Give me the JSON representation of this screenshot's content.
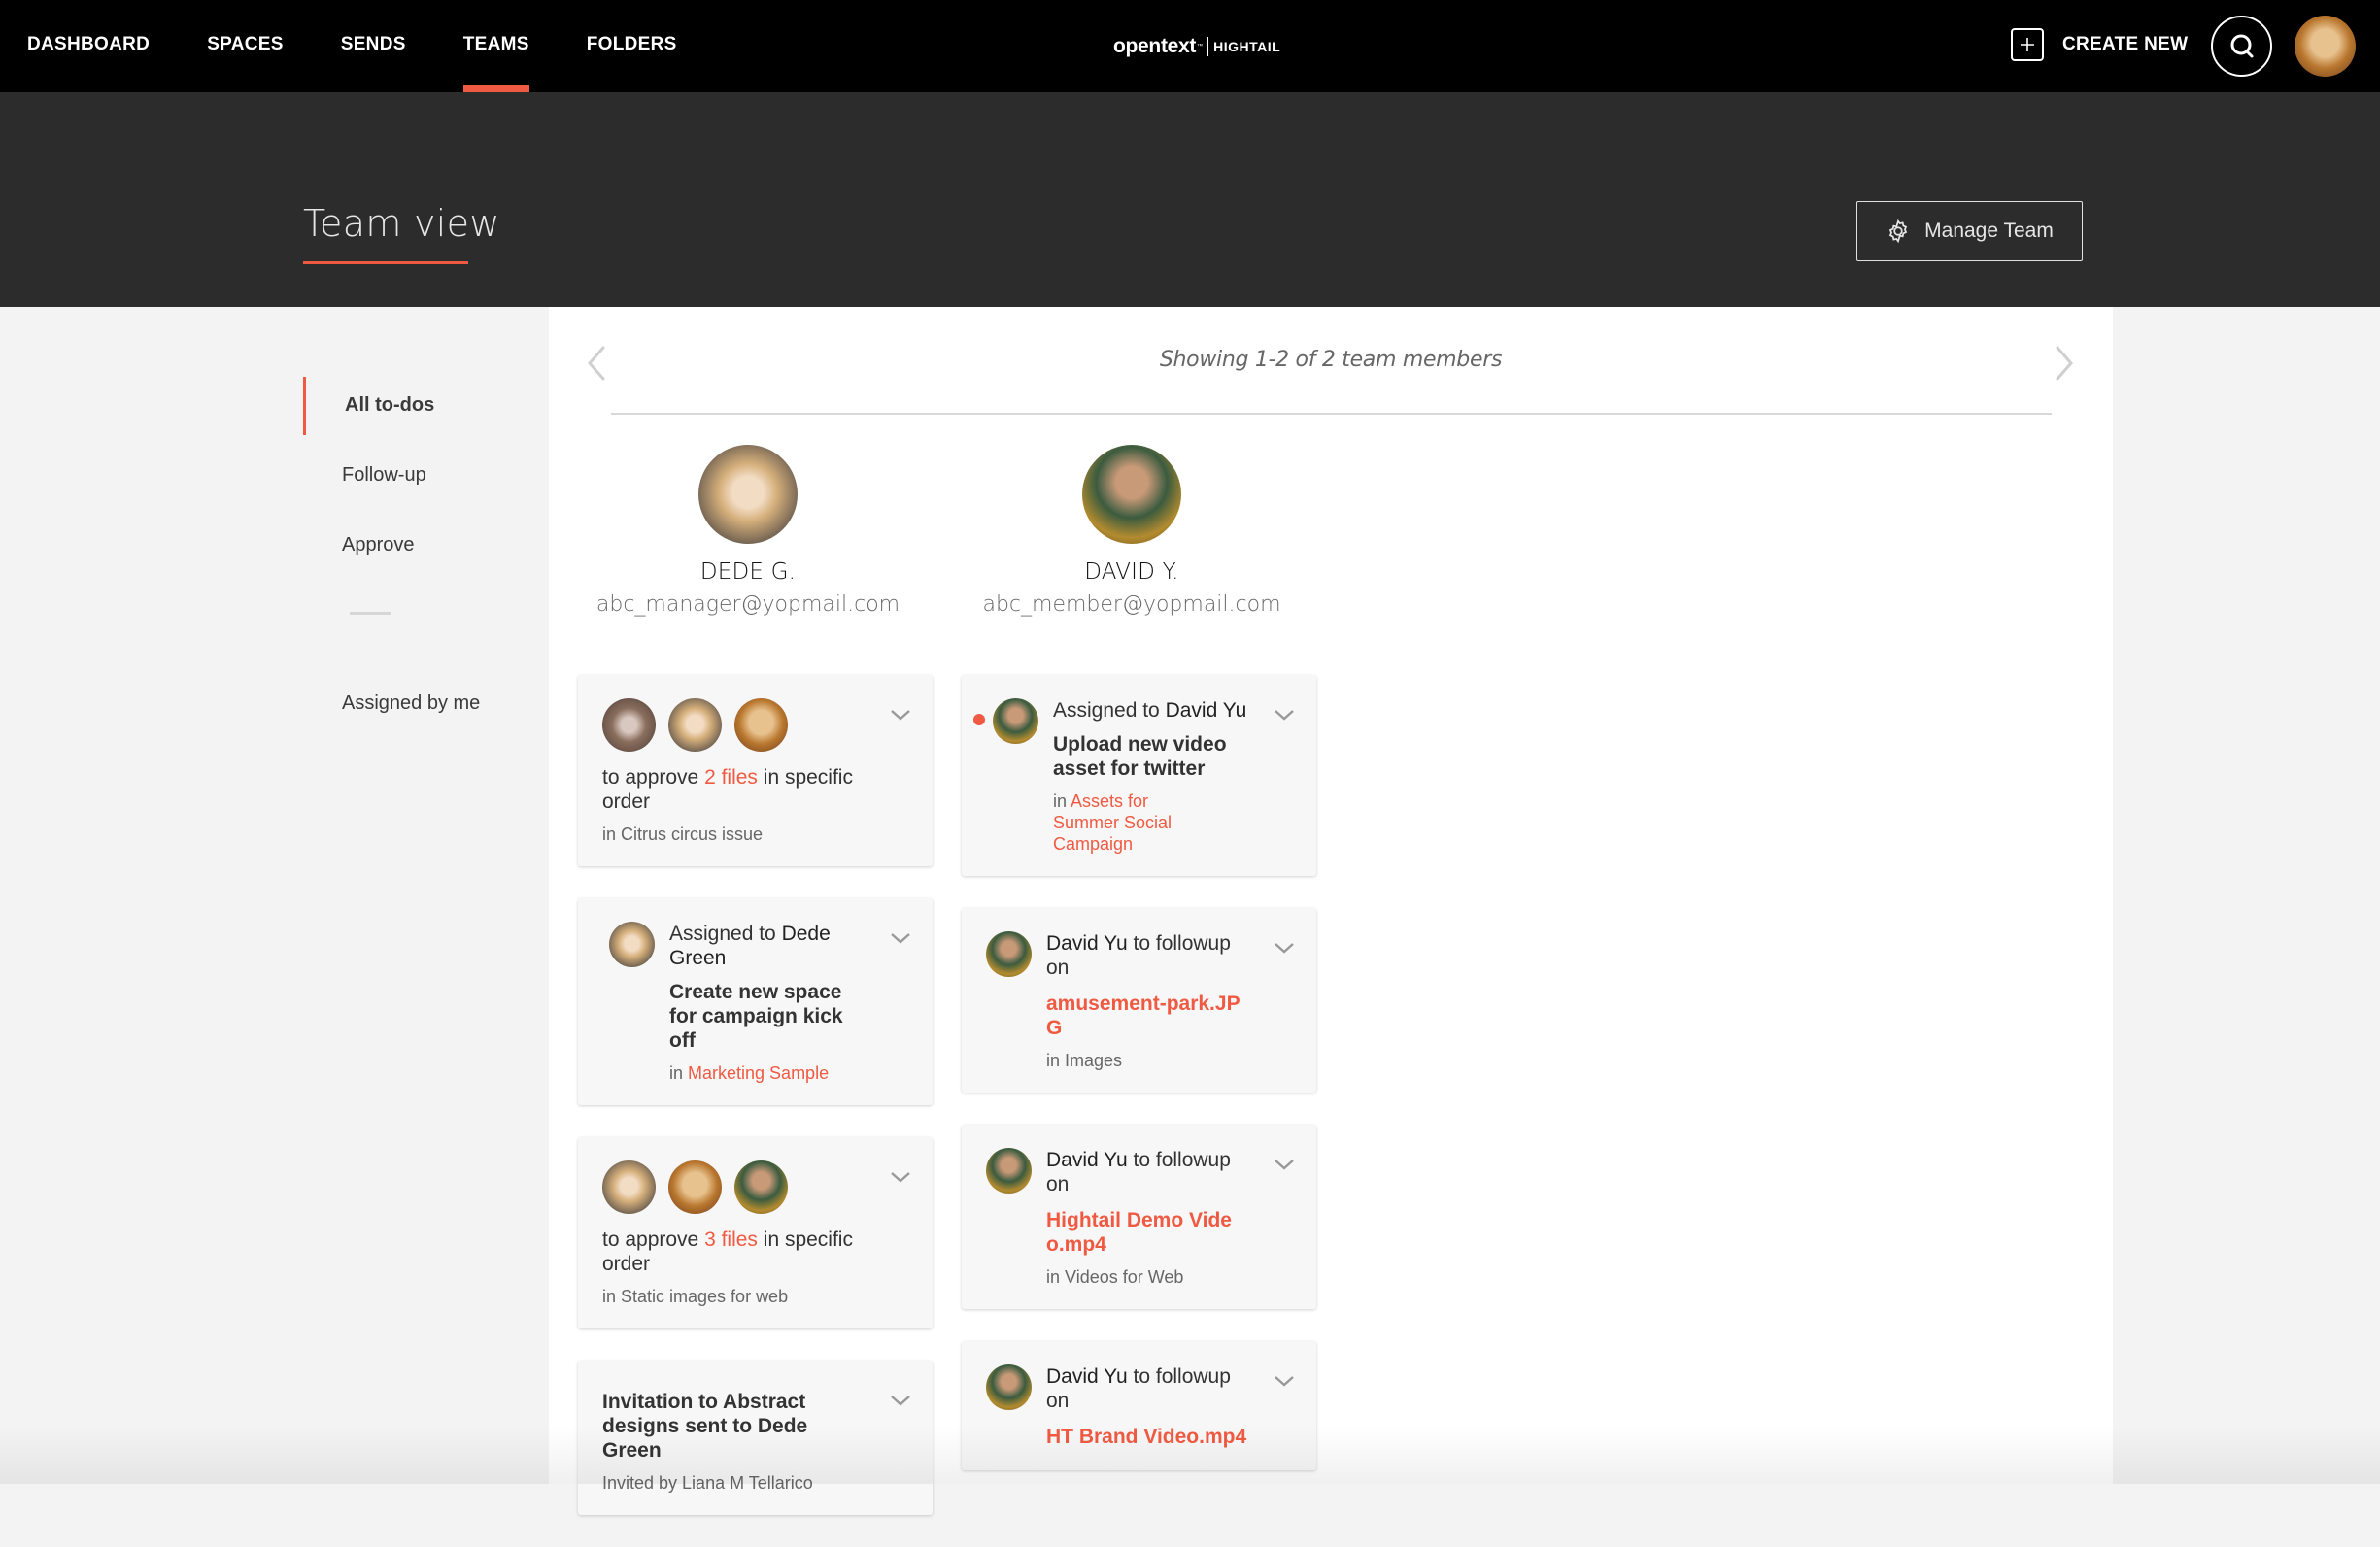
{
  "topnav": {
    "items": [
      {
        "label": "DASHBOARD",
        "active": false
      },
      {
        "label": "SPACES",
        "active": false
      },
      {
        "label": "SENDS",
        "active": false
      },
      {
        "label": "TEAMS",
        "active": true
      },
      {
        "label": "FOLDERS",
        "active": false
      }
    ],
    "logo": {
      "brand": "opentext",
      "tm": "™",
      "product": "HIGHTAIL"
    },
    "create_new_label": "CREATE NEW",
    "icons": {
      "create": "plus-icon",
      "search": "search-icon",
      "profile": "user-avatar"
    }
  },
  "header": {
    "title": "Team view",
    "manage_team_label": "Manage Team"
  },
  "sidebar": {
    "items": [
      {
        "label": "All to-dos",
        "active": true
      },
      {
        "label": "Follow-up",
        "active": false
      },
      {
        "label": "Approve",
        "active": false
      },
      {
        "label": "Assigned by me",
        "active": false
      }
    ]
  },
  "main": {
    "showing_text": "Showing 1-2 of 2 team members",
    "members": [
      {
        "name": "DEDE G.",
        "email": "abc_manager@yopmail.com"
      },
      {
        "name": "DAVID Y.",
        "email": "abc_member@yopmail.com"
      }
    ],
    "columns": [
      {
        "cards": [
          {
            "type": "approve",
            "prefix": "to approve ",
            "link": "2 files",
            "suffix": " in specific order",
            "location": "in Citrus circus issue"
          },
          {
            "type": "assigned",
            "assigned_prefix": "Assigned to ",
            "assignee": "Dede Green",
            "title": "Create new space for campaign kick off",
            "in": "in ",
            "location": "Marketing Sample"
          },
          {
            "type": "approve",
            "prefix": "to approve ",
            "link": "3 files",
            "suffix": " in specific order",
            "location": "in Static images for web"
          },
          {
            "type": "invitation",
            "title": "Invitation to Abstract designs sent to Dede Green",
            "subtitle": "Invited by Liana M Tellarico"
          }
        ]
      },
      {
        "cards": [
          {
            "type": "assigned",
            "unread": true,
            "assigned_prefix": "Assigned to ",
            "assignee": "David Yu",
            "title": "Upload new video asset for twitter",
            "in": "in ",
            "location": "Assets for Summer Social Campaign"
          },
          {
            "type": "followup",
            "who": "David Yu",
            "action": " to followup on",
            "file": "amusement-park.JPG",
            "location": "in Images"
          },
          {
            "type": "followup",
            "who": "David Yu",
            "action": " to followup on",
            "file": "Hightail Demo Video.mp4",
            "location": "in Videos for Web"
          },
          {
            "type": "followup",
            "who": "David Yu",
            "action": " to followup on",
            "file": "HT Brand Video.mp4"
          }
        ]
      }
    ]
  },
  "colors": {
    "accent": "#f05a42",
    "nav_bg": "#000000",
    "band_bg": "#2c2c2c",
    "page_bg": "#f3f3f3",
    "card_bg": "#f7f7f7"
  }
}
